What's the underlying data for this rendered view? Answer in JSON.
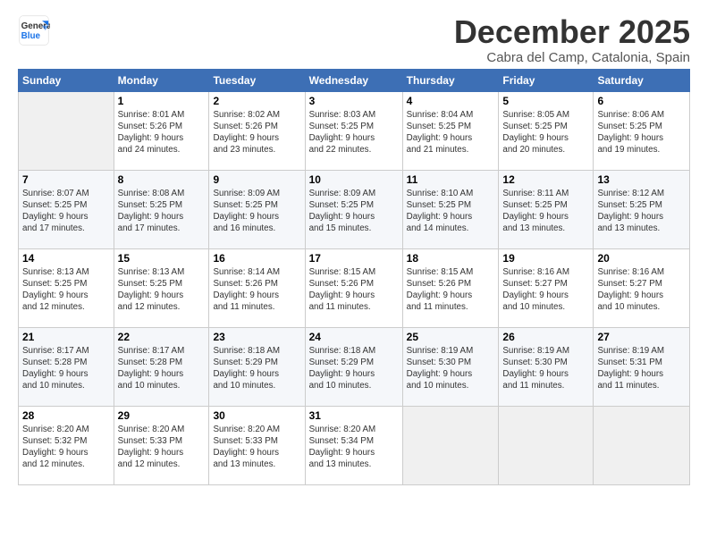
{
  "logo": {
    "line1": "General",
    "line2": "Blue"
  },
  "calendar": {
    "title": "December 2025",
    "subtitle": "Cabra del Camp, Catalonia, Spain",
    "header_color": "#3d6fb5",
    "days_of_week": [
      "Sunday",
      "Monday",
      "Tuesday",
      "Wednesday",
      "Thursday",
      "Friday",
      "Saturday"
    ],
    "weeks": [
      [
        {
          "date": "",
          "info": ""
        },
        {
          "date": "1",
          "info": "Sunrise: 8:01 AM\nSunset: 5:26 PM\nDaylight: 9 hours\nand 24 minutes."
        },
        {
          "date": "2",
          "info": "Sunrise: 8:02 AM\nSunset: 5:26 PM\nDaylight: 9 hours\nand 23 minutes."
        },
        {
          "date": "3",
          "info": "Sunrise: 8:03 AM\nSunset: 5:25 PM\nDaylight: 9 hours\nand 22 minutes."
        },
        {
          "date": "4",
          "info": "Sunrise: 8:04 AM\nSunset: 5:25 PM\nDaylight: 9 hours\nand 21 minutes."
        },
        {
          "date": "5",
          "info": "Sunrise: 8:05 AM\nSunset: 5:25 PM\nDaylight: 9 hours\nand 20 minutes."
        },
        {
          "date": "6",
          "info": "Sunrise: 8:06 AM\nSunset: 5:25 PM\nDaylight: 9 hours\nand 19 minutes."
        }
      ],
      [
        {
          "date": "7",
          "info": "Sunrise: 8:07 AM\nSunset: 5:25 PM\nDaylight: 9 hours\nand 17 minutes."
        },
        {
          "date": "8",
          "info": "Sunrise: 8:08 AM\nSunset: 5:25 PM\nDaylight: 9 hours\nand 17 minutes."
        },
        {
          "date": "9",
          "info": "Sunrise: 8:09 AM\nSunset: 5:25 PM\nDaylight: 9 hours\nand 16 minutes."
        },
        {
          "date": "10",
          "info": "Sunrise: 8:09 AM\nSunset: 5:25 PM\nDaylight: 9 hours\nand 15 minutes."
        },
        {
          "date": "11",
          "info": "Sunrise: 8:10 AM\nSunset: 5:25 PM\nDaylight: 9 hours\nand 14 minutes."
        },
        {
          "date": "12",
          "info": "Sunrise: 8:11 AM\nSunset: 5:25 PM\nDaylight: 9 hours\nand 13 minutes."
        },
        {
          "date": "13",
          "info": "Sunrise: 8:12 AM\nSunset: 5:25 PM\nDaylight: 9 hours\nand 13 minutes."
        }
      ],
      [
        {
          "date": "14",
          "info": "Sunrise: 8:13 AM\nSunset: 5:25 PM\nDaylight: 9 hours\nand 12 minutes."
        },
        {
          "date": "15",
          "info": "Sunrise: 8:13 AM\nSunset: 5:25 PM\nDaylight: 9 hours\nand 12 minutes."
        },
        {
          "date": "16",
          "info": "Sunrise: 8:14 AM\nSunset: 5:26 PM\nDaylight: 9 hours\nand 11 minutes."
        },
        {
          "date": "17",
          "info": "Sunrise: 8:15 AM\nSunset: 5:26 PM\nDaylight: 9 hours\nand 11 minutes."
        },
        {
          "date": "18",
          "info": "Sunrise: 8:15 AM\nSunset: 5:26 PM\nDaylight: 9 hours\nand 11 minutes."
        },
        {
          "date": "19",
          "info": "Sunrise: 8:16 AM\nSunset: 5:27 PM\nDaylight: 9 hours\nand 10 minutes."
        },
        {
          "date": "20",
          "info": "Sunrise: 8:16 AM\nSunset: 5:27 PM\nDaylight: 9 hours\nand 10 minutes."
        }
      ],
      [
        {
          "date": "21",
          "info": "Sunrise: 8:17 AM\nSunset: 5:28 PM\nDaylight: 9 hours\nand 10 minutes."
        },
        {
          "date": "22",
          "info": "Sunrise: 8:17 AM\nSunset: 5:28 PM\nDaylight: 9 hours\nand 10 minutes."
        },
        {
          "date": "23",
          "info": "Sunrise: 8:18 AM\nSunset: 5:29 PM\nDaylight: 9 hours\nand 10 minutes."
        },
        {
          "date": "24",
          "info": "Sunrise: 8:18 AM\nSunset: 5:29 PM\nDaylight: 9 hours\nand 10 minutes."
        },
        {
          "date": "25",
          "info": "Sunrise: 8:19 AM\nSunset: 5:30 PM\nDaylight: 9 hours\nand 10 minutes."
        },
        {
          "date": "26",
          "info": "Sunrise: 8:19 AM\nSunset: 5:30 PM\nDaylight: 9 hours\nand 11 minutes."
        },
        {
          "date": "27",
          "info": "Sunrise: 8:19 AM\nSunset: 5:31 PM\nDaylight: 9 hours\nand 11 minutes."
        }
      ],
      [
        {
          "date": "28",
          "info": "Sunrise: 8:20 AM\nSunset: 5:32 PM\nDaylight: 9 hours\nand 12 minutes."
        },
        {
          "date": "29",
          "info": "Sunrise: 8:20 AM\nSunset: 5:33 PM\nDaylight: 9 hours\nand 12 minutes."
        },
        {
          "date": "30",
          "info": "Sunrise: 8:20 AM\nSunset: 5:33 PM\nDaylight: 9 hours\nand 13 minutes."
        },
        {
          "date": "31",
          "info": "Sunrise: 8:20 AM\nSunset: 5:34 PM\nDaylight: 9 hours\nand 13 minutes."
        },
        {
          "date": "",
          "info": ""
        },
        {
          "date": "",
          "info": ""
        },
        {
          "date": "",
          "info": ""
        }
      ]
    ]
  }
}
